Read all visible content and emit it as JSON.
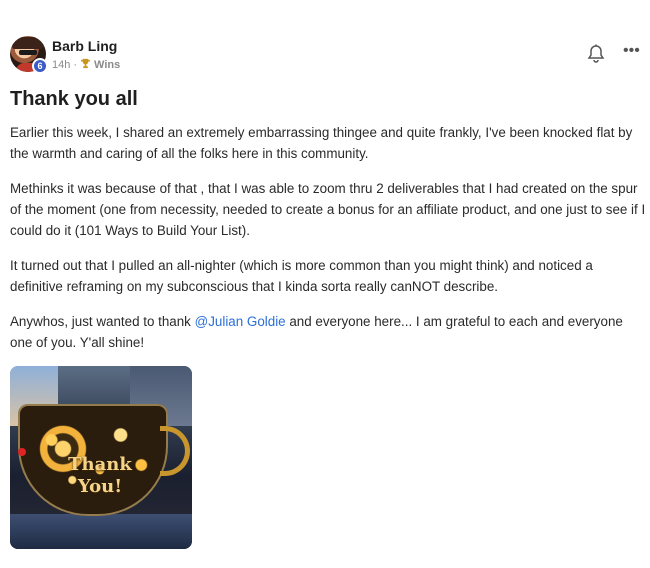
{
  "post": {
    "author": {
      "name": "Barb Ling",
      "level": "6"
    },
    "time": "14h",
    "separator": "·",
    "category": "Wins",
    "icons": {
      "avatar": "avatar",
      "level": "level-badge",
      "category": "trophy-icon",
      "notify": "bell-icon",
      "more": "more-icon"
    },
    "more_glyph": "•••",
    "title": "Thank you all",
    "paragraphs": [
      "Earlier this week, I shared an extremely embarrassing thingee and quite frankly, I've been knocked flat by the warmth and caring of all the folks here in this community.",
      "Methinks it was because of that , that I was able to zoom thru 2 deliverables that I had created on the spur of the moment (one from necessity, needed to create a bonus for an affiliate product, and one just to see if I could do it (101 Ways to Build Your List).",
      "It turned out that I pulled an all-nighter (which is more common than you might think) and noticed a definitive reframing on my subconscious that I kinda sorta really canNOT describe."
    ],
    "last_paragraph": {
      "before": "Anywhos, just wanted to thank ",
      "mention": "@Julian Goldie",
      "after": " and everyone here... I am grateful to each and everyone one of you. Y'all shine!"
    },
    "image": {
      "caption_line1": "Thank",
      "caption_line2": "You!"
    },
    "colors": {
      "mention": "#2c6fd6",
      "level_badge": "#3b5bc7",
      "trophy": "#c8961e"
    }
  }
}
